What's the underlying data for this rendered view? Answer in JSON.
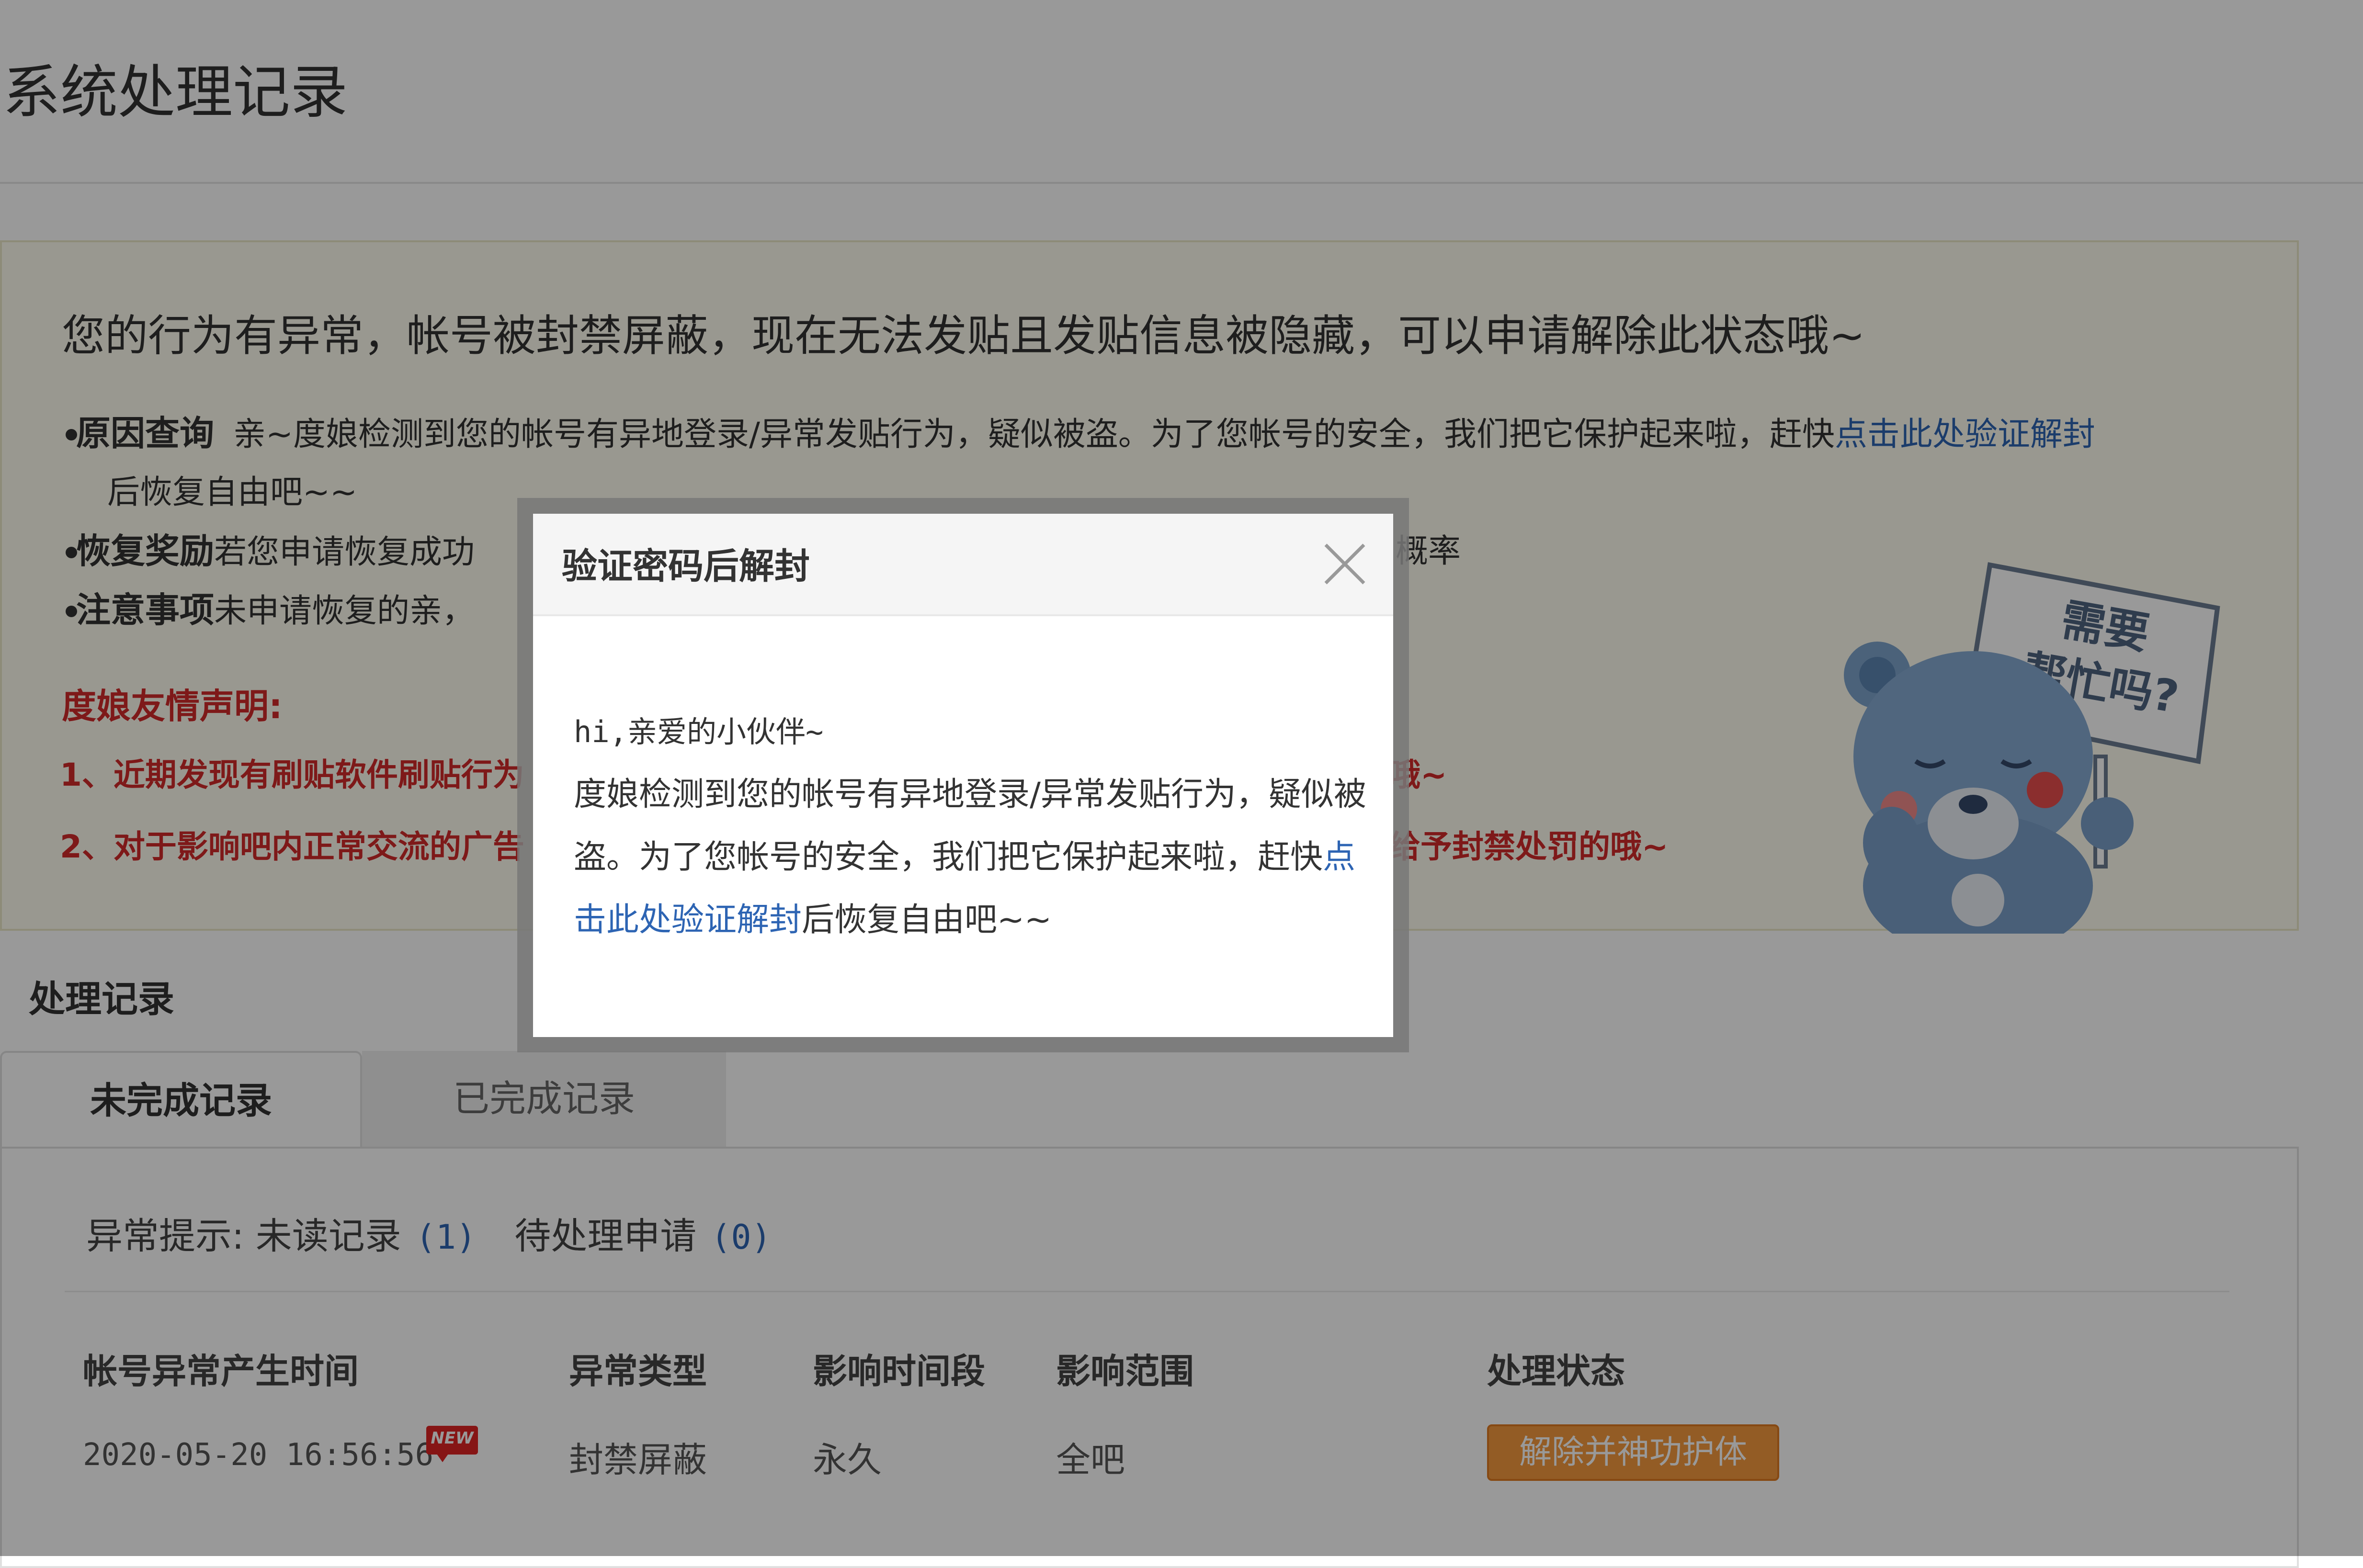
{
  "page": {
    "title": "系统处理记录"
  },
  "notice": {
    "heading": "您的行为有异常，帐号被封禁屏蔽，现在无法发贴且发贴信息被隐藏，可以申请解除此状态哦~",
    "reason_label": "原因查询",
    "reason_text": "亲~度娘检测到您的帐号有异地登录/异常发贴行为，疑似被盗。为了您帐号的安全，我们把它保护起来啦，赶快",
    "reason_link": "点击此处验证解封",
    "reason_cont": "后恢复自由吧~~",
    "reward_label": "恢复奖励",
    "reward_text": "若您申请恢复成功",
    "reward_tail": "概率",
    "attention_label": "注意事项",
    "attention_text": "未申请恢复的亲，",
    "decl_title": "度娘友情声明:",
    "decl_1": "1、近期发现有刷贴软件刷贴行为",
    "decl_1_tail": "哦~",
    "decl_2": "2、对于影响吧内正常交流的广告",
    "decl_2_tail": "给予封禁处罚的哦~",
    "mascot_sign": "需要帮忙吗?"
  },
  "records": {
    "section_title": "处理记录",
    "tabs": [
      {
        "label": "未完成记录",
        "active": true
      },
      {
        "label": "已完成记录",
        "active": false
      }
    ],
    "summary_label": "异常提示:",
    "unread_label": "未读记录",
    "unread_count": "(1)",
    "pending_label": "待处理申请",
    "pending_count": "(0)",
    "columns": [
      "帐号异常产生时间",
      "异常类型",
      "影响时间段",
      "影响范围",
      "处理状态"
    ],
    "rows": [
      {
        "time": "2020-05-20 16:56:56",
        "badge": "NEW",
        "type": "封禁屏蔽",
        "duration": "永久",
        "scope": "全吧",
        "action": "解除并神功护体"
      }
    ]
  },
  "modal": {
    "title": "验证密码后解封",
    "greeting": "hi,亲爱的小伙伴~",
    "body_1": "度娘检测到您的帐号有异地登录/异常发贴行为，疑似被盗。为了您帐号的安全，我们把它保护起来啦，赶快",
    "link": "点击此处验证解封",
    "body_2": "后恢复自由吧~~"
  },
  "colors": {
    "link": "#2d64b3",
    "alert_red": "#d22b2b",
    "action_orange": "#f59a3f",
    "notice_bg": "#fffef0"
  }
}
